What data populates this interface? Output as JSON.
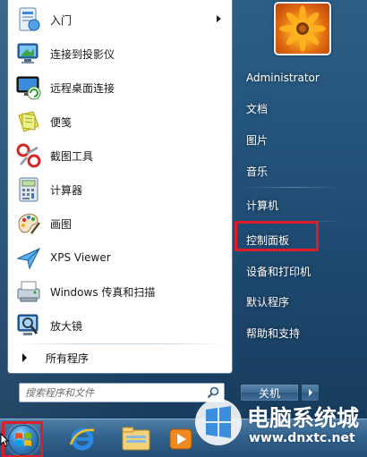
{
  "programs": [
    {
      "label": "入门",
      "icon": "getting-started-icon",
      "has_submenu": true
    },
    {
      "label": "连接到投影仪",
      "icon": "projector-icon",
      "has_submenu": false
    },
    {
      "label": "远程桌面连接",
      "icon": "remote-desktop-icon",
      "has_submenu": false
    },
    {
      "label": "便笺",
      "icon": "sticky-notes-icon",
      "has_submenu": false
    },
    {
      "label": "截图工具",
      "icon": "snipping-tool-icon",
      "has_submenu": false
    },
    {
      "label": "计算器",
      "icon": "calculator-icon",
      "has_submenu": false
    },
    {
      "label": "画图",
      "icon": "paint-icon",
      "has_submenu": false
    },
    {
      "label": "XPS Viewer",
      "icon": "xps-viewer-icon",
      "has_submenu": false
    },
    {
      "label": "Windows 传真和扫描",
      "icon": "fax-scan-icon",
      "has_submenu": false
    },
    {
      "label": "放大镜",
      "icon": "magnifier-icon",
      "has_submenu": false
    }
  ],
  "all_programs": {
    "label": "所有程序"
  },
  "search": {
    "placeholder": "搜索程序和文件"
  },
  "right_items": [
    {
      "label": "Administrator"
    },
    {
      "label": "文档"
    },
    {
      "label": "图片"
    },
    {
      "label": "音乐"
    },
    {
      "label": "计算机"
    },
    {
      "label": "控制面板",
      "highlighted": true
    },
    {
      "label": "设备和打印机"
    },
    {
      "label": "默认程序"
    },
    {
      "label": "帮助和支持"
    }
  ],
  "shutdown": {
    "label": "关机"
  },
  "taskbar": {
    "pinned": [
      "internet-explorer-icon",
      "windows-explorer-icon",
      "media-player-icon"
    ]
  },
  "watermark": {
    "title": "电脑系统城",
    "url": "www.dnxtc.net"
  },
  "colors": {
    "highlight_border": "#e01b2a",
    "menu_background": "#1f4c73",
    "taskbar": "#33638d"
  }
}
